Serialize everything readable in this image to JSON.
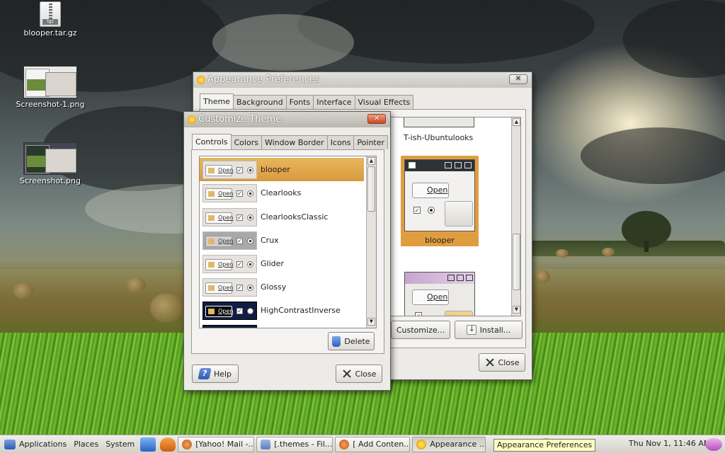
{
  "desktop": {
    "icons": [
      {
        "label": "blooper.tar.gz",
        "icon": "archive-icon"
      },
      {
        "label": "Screenshot-1.png",
        "icon": "image-icon"
      },
      {
        "label": "Screenshot.png",
        "icon": "image-icon"
      }
    ]
  },
  "appearance": {
    "title": "Appearance Preferences",
    "close_glyph": "✕",
    "tabs": [
      "Theme",
      "Background",
      "Fonts",
      "Interface",
      "Visual Effects"
    ],
    "active_tab": "Theme",
    "themes": [
      {
        "label": "T-ish-Ubuntulooks"
      },
      {
        "label": "blooper",
        "selected": true,
        "open_label": "Open"
      },
      {
        "label": "",
        "open_label": "Open"
      }
    ],
    "customize_label": "Customize...",
    "install_label": "Install...",
    "close_label": "Close"
  },
  "customize": {
    "title": "Customize Theme",
    "close_glyph": "✕",
    "tabs": [
      "Controls",
      "Colors",
      "Window Border",
      "Icons",
      "Pointer"
    ],
    "active_tab": "Controls",
    "open_label": "Open",
    "items": [
      {
        "label": "blooper",
        "selected": true
      },
      {
        "label": "Clearlooks"
      },
      {
        "label": "ClearlooksClassic"
      },
      {
        "label": "Crux"
      },
      {
        "label": "Glider"
      },
      {
        "label": "Glossy"
      },
      {
        "label": "HighContrastInverse"
      }
    ],
    "check_glyph": "✓",
    "delete_label": "Delete",
    "help_label": "Help",
    "close_label": "Close"
  },
  "taskbar": {
    "menus": [
      "Applications",
      "Places",
      "System"
    ],
    "tasks": [
      {
        "label": "[Yahoo! Mail -..."
      },
      {
        "label": "[.themes - Fil..."
      },
      {
        "label": "[ Add Conten..."
      },
      {
        "label": "Appearance ...",
        "active": true
      }
    ],
    "tooltip": "Appearance Preferences",
    "clock": "Thu Nov  1, 11:46 AM"
  }
}
